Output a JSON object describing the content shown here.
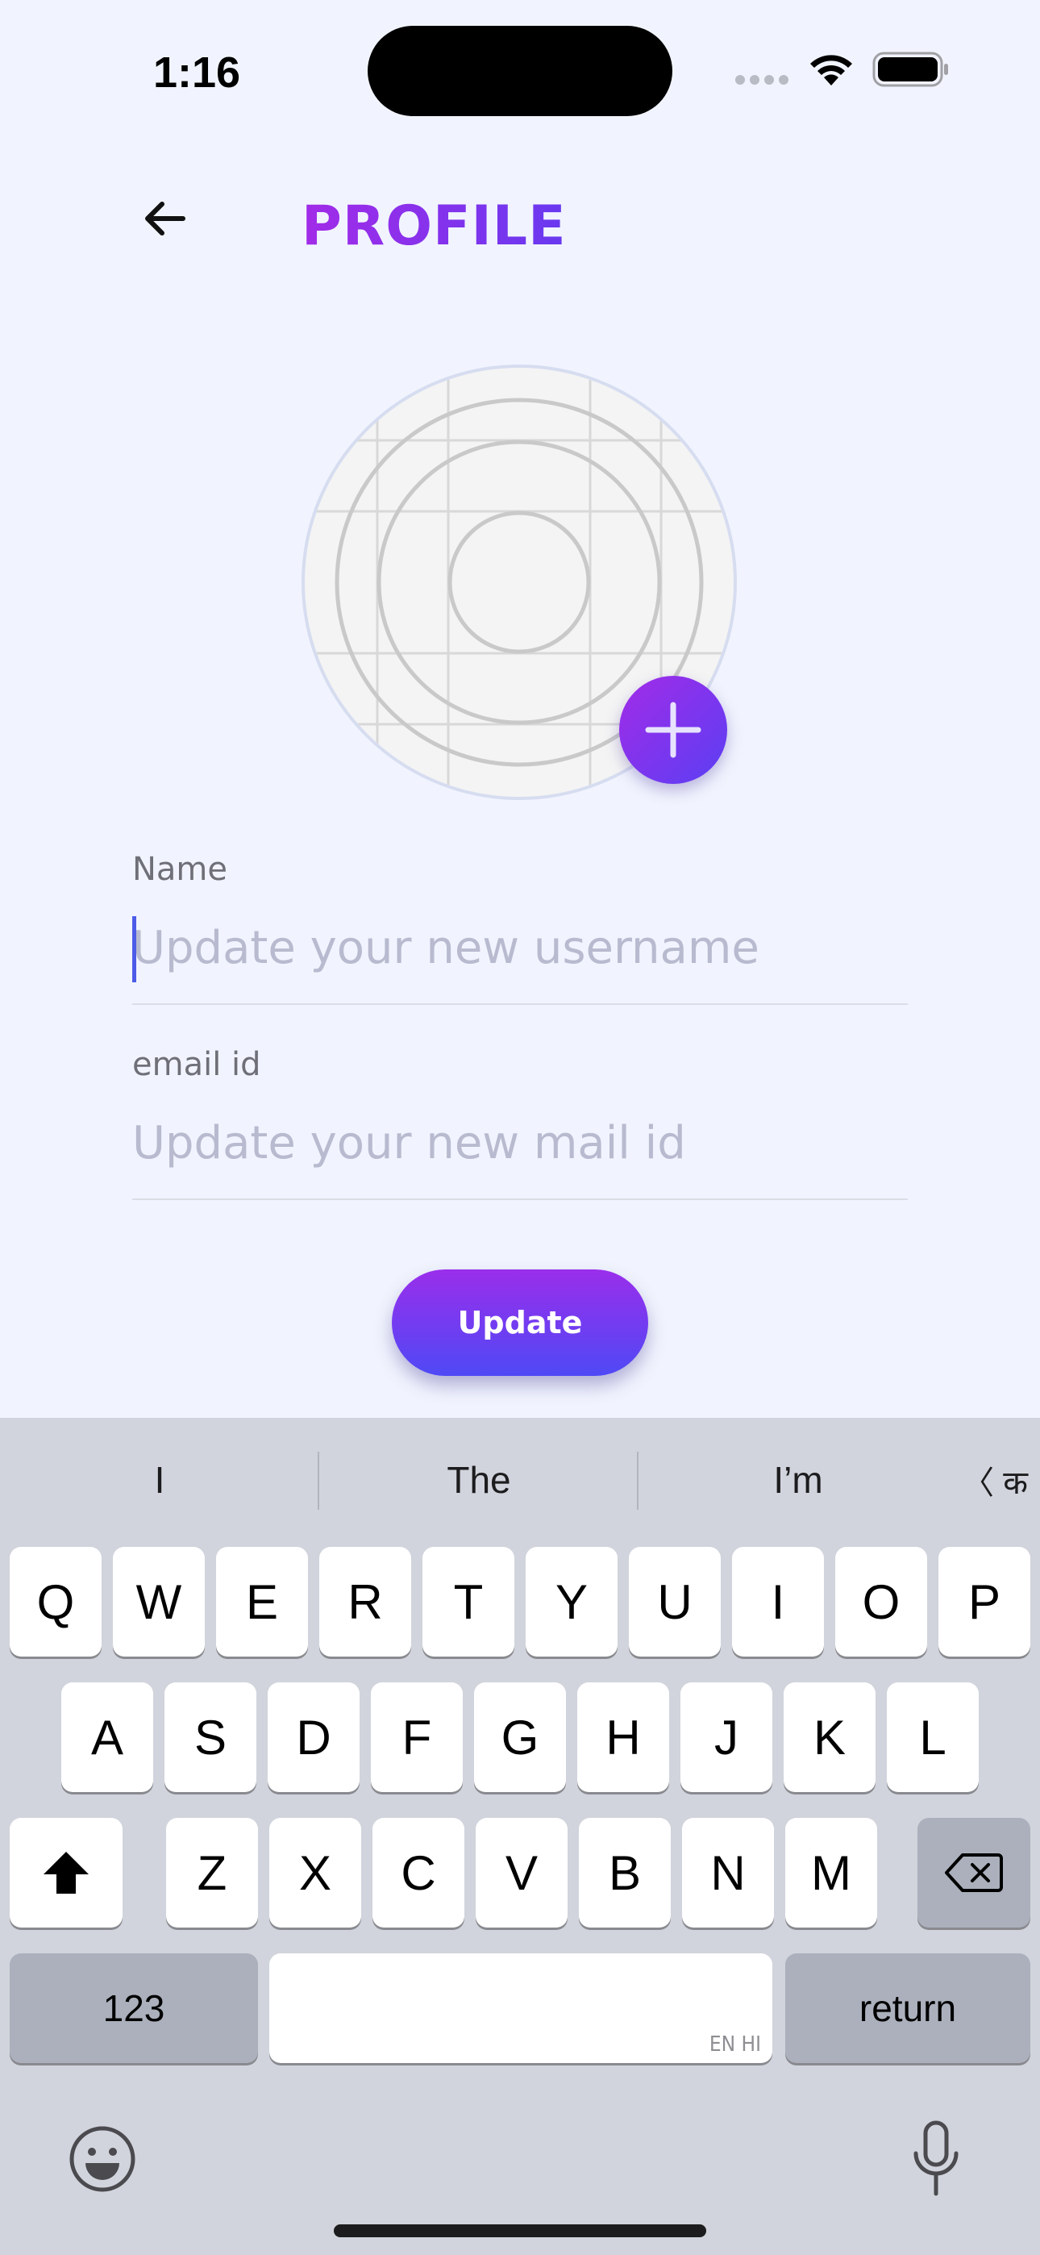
{
  "status_bar": {
    "time": "1:16"
  },
  "header": {
    "title": "PROFILE"
  },
  "form": {
    "name": {
      "label": "Name",
      "placeholder": "Update your new username"
    },
    "email": {
      "label": "email id",
      "placeholder": "Update your new mail id"
    },
    "update_label": "Update"
  },
  "keyboard": {
    "suggestions": [
      "I",
      "The",
      "I’m"
    ],
    "lang_switch": "〈 क",
    "row1": [
      "Q",
      "W",
      "E",
      "R",
      "T",
      "Y",
      "U",
      "I",
      "O",
      "P"
    ],
    "row2": [
      "A",
      "S",
      "D",
      "F",
      "G",
      "H",
      "J",
      "K",
      "L"
    ],
    "row3": [
      "Z",
      "X",
      "C",
      "V",
      "B",
      "N",
      "M"
    ],
    "numbers_label": "123",
    "return_label": "return",
    "space_hint": "EN HI"
  },
  "colors": {
    "background": "#F1F4FE",
    "accent_start": "#A22BE8",
    "accent_end": "#4F49F5"
  }
}
